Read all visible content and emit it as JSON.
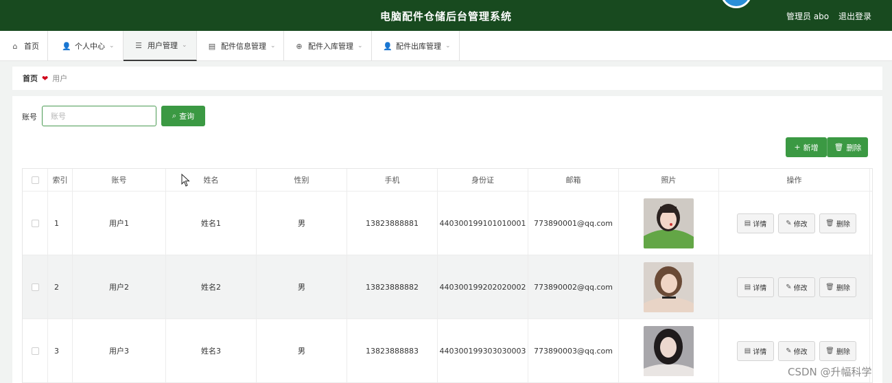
{
  "header": {
    "title": "电脑配件仓储后台管理系统",
    "user": "管理员 abo",
    "logout": "退出登录"
  },
  "nav": {
    "tabs": [
      {
        "label": "首页",
        "icon": "home-icon",
        "glyph": "⌂",
        "chev": ""
      },
      {
        "label": "个人中心",
        "icon": "person-icon",
        "glyph": "👤",
        "chev": "⌄"
      },
      {
        "label": "用户管理",
        "icon": "list-icon",
        "glyph": "☰",
        "chev": "⌄"
      },
      {
        "label": "配件信息管理",
        "icon": "stack-icon",
        "glyph": "▤",
        "chev": "⌄"
      },
      {
        "label": "配件入库管理",
        "icon": "circle-icon",
        "glyph": "⊕",
        "chev": "⌄"
      },
      {
        "label": "配件出库管理",
        "icon": "person-icon",
        "glyph": "👤",
        "chev": "⌄"
      }
    ]
  },
  "breadcrumb": {
    "home": "首页",
    "current": "用户"
  },
  "search": {
    "label": "账号",
    "placeholder": "账号",
    "query_label": "查询"
  },
  "toolbar": {
    "add_label": "新增",
    "delete_label": "删除"
  },
  "table": {
    "columns": [
      "",
      "索引",
      "账号",
      "姓名",
      "性别",
      "手机",
      "身份证",
      "邮箱",
      "照片",
      "操作"
    ],
    "rows": [
      {
        "index": "1",
        "account": "用户1",
        "name": "姓名1",
        "gender": "男",
        "phone": "13823888881",
        "id_card": "440300199101010001",
        "email": "773890001@qq.com"
      },
      {
        "index": "2",
        "account": "用户2",
        "name": "姓名2",
        "gender": "男",
        "phone": "13823888882",
        "id_card": "440300199202020002",
        "email": "773890002@qq.com"
      },
      {
        "index": "3",
        "account": "用户3",
        "name": "姓名3",
        "gender": "男",
        "phone": "13823888883",
        "id_card": "440300199303030003",
        "email": "773890003@qq.com"
      }
    ],
    "actions": {
      "detail": "详情",
      "edit": "修改",
      "delete": "删除"
    }
  },
  "watermark": "CSDN @升幅科学",
  "colors": {
    "header_bg": "#184a1f",
    "accent_green": "#3b9943",
    "heart": "#d0021b"
  }
}
